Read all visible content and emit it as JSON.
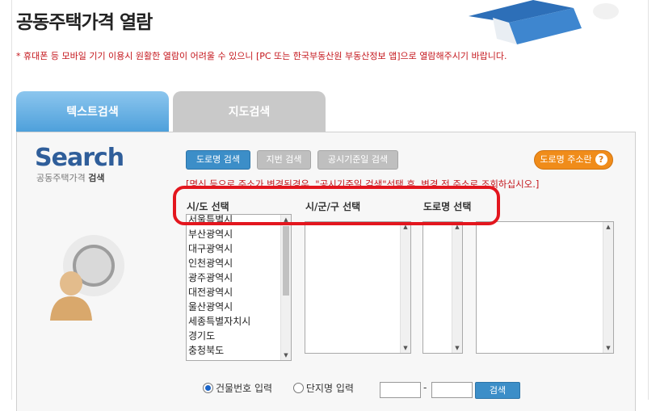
{
  "page": {
    "title": "공동주택가격 열람",
    "notice": "* 휴대폰 등 모바일 기기 이용시 원활한 열람이 어려울 수 있으니 [PC 또는 한국부동산원 부동산정보 앱]으로 열람해주시기 바랍니다."
  },
  "tabs": [
    {
      "label": "텍스트검색",
      "active": true
    },
    {
      "label": "지도검색",
      "active": false
    }
  ],
  "search_logo": {
    "big": "Search",
    "sub_prefix": "공동주택가격 ",
    "sub_bold": "검색"
  },
  "buttons": {
    "road": "도로명 검색",
    "jibun": "지번 검색",
    "date": "공시기준일 검색",
    "road_addr": "도로명 주소란",
    "go": "검색"
  },
  "hint": "[명신 등으로 주소가 변경된경우, \"공시기준일 검색\"선택 후, 변경 전 주소로 조회하십시오.]",
  "columns": {
    "sido": "시/도 선택",
    "sigungu": "시/군/구 선택",
    "road": "도로명 선택"
  },
  "sido_list": [
    "서울특별시",
    "부산광역시",
    "대구광역시",
    "인천광역시",
    "광주광역시",
    "대전광역시",
    "울산광역시",
    "세종특별자치시",
    "경기도",
    "충청북도"
  ],
  "radio": {
    "building_no": "건물번호 입력",
    "complex_name": "단지명 입력",
    "selected": "building_no"
  },
  "dash": "-",
  "colors": {
    "accent_blue": "#3c8ec8",
    "notice_red": "#c4161c",
    "orange": "#f08c1a",
    "highlight_red": "#e3161e"
  }
}
